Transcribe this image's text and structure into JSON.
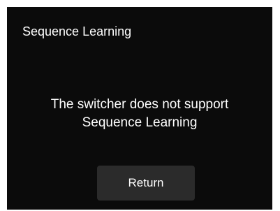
{
  "dialog": {
    "title": "Sequence Learning",
    "message_line1": "The switcher does not support",
    "message_line2": "Sequence Learning",
    "return_label": "Return"
  },
  "colors": {
    "background": "#0b0b0b",
    "button": "#2b2b2b",
    "text": "#ffffff"
  }
}
